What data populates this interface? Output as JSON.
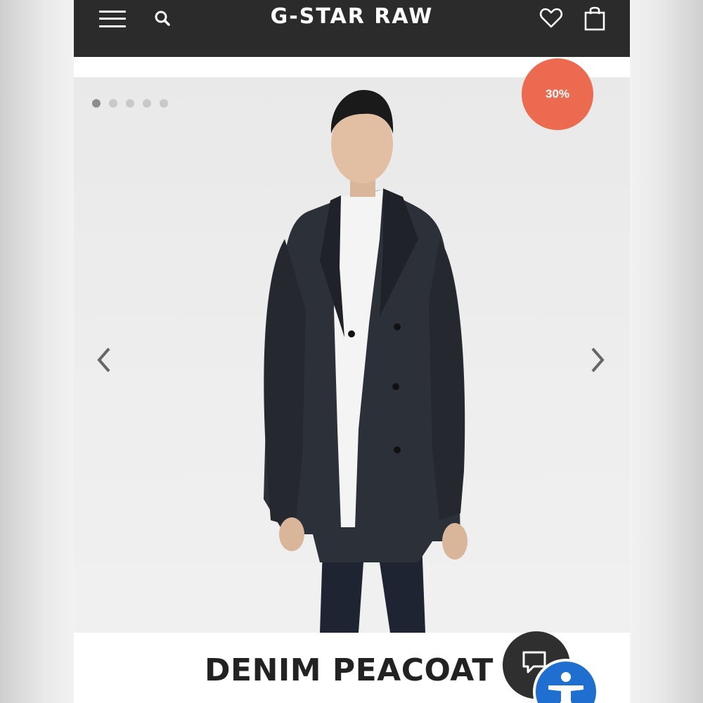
{
  "header": {
    "brand": "G-STAR RAW",
    "icons": {
      "menu": "hamburger-menu-icon",
      "search": "search-icon",
      "wishlist": "heart-icon",
      "cart": "shopping-bag-icon"
    },
    "background": "#2b2b2b"
  },
  "gallery": {
    "slide_count": 5,
    "active_slide": 1,
    "discount_badge": "30%",
    "badge_color": "#ec6a50",
    "prev_icon": "chevron-left-icon",
    "next_icon": "chevron-right-icon"
  },
  "product": {
    "title": "DENIM PEACOAT"
  },
  "floating": {
    "chat_icon": "chat-bubble-icon",
    "accessibility_icon": "accessibility-person-icon",
    "accessibility_color": "#1f6fd1"
  }
}
